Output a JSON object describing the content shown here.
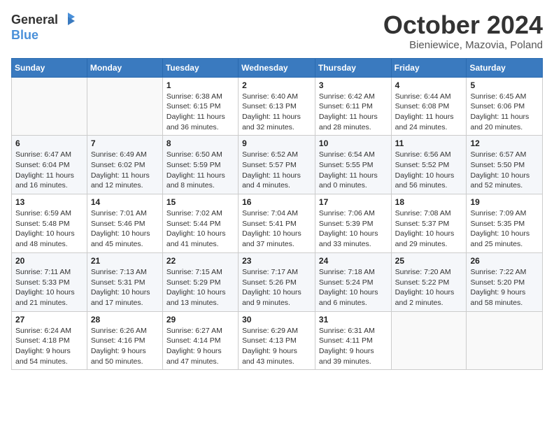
{
  "logo": {
    "text_general": "General",
    "text_blue": "Blue"
  },
  "title": {
    "month": "October 2024",
    "location": "Bieniewice, Mazovia, Poland"
  },
  "weekdays": [
    "Sunday",
    "Monday",
    "Tuesday",
    "Wednesday",
    "Thursday",
    "Friday",
    "Saturday"
  ],
  "weeks": [
    [
      {
        "day": "",
        "info": ""
      },
      {
        "day": "",
        "info": ""
      },
      {
        "day": "1",
        "info": "Sunrise: 6:38 AM\nSunset: 6:15 PM\nDaylight: 11 hours and 36 minutes."
      },
      {
        "day": "2",
        "info": "Sunrise: 6:40 AM\nSunset: 6:13 PM\nDaylight: 11 hours and 32 minutes."
      },
      {
        "day": "3",
        "info": "Sunrise: 6:42 AM\nSunset: 6:11 PM\nDaylight: 11 hours and 28 minutes."
      },
      {
        "day": "4",
        "info": "Sunrise: 6:44 AM\nSunset: 6:08 PM\nDaylight: 11 hours and 24 minutes."
      },
      {
        "day": "5",
        "info": "Sunrise: 6:45 AM\nSunset: 6:06 PM\nDaylight: 11 hours and 20 minutes."
      }
    ],
    [
      {
        "day": "6",
        "info": "Sunrise: 6:47 AM\nSunset: 6:04 PM\nDaylight: 11 hours and 16 minutes."
      },
      {
        "day": "7",
        "info": "Sunrise: 6:49 AM\nSunset: 6:02 PM\nDaylight: 11 hours and 12 minutes."
      },
      {
        "day": "8",
        "info": "Sunrise: 6:50 AM\nSunset: 5:59 PM\nDaylight: 11 hours and 8 minutes."
      },
      {
        "day": "9",
        "info": "Sunrise: 6:52 AM\nSunset: 5:57 PM\nDaylight: 11 hours and 4 minutes."
      },
      {
        "day": "10",
        "info": "Sunrise: 6:54 AM\nSunset: 5:55 PM\nDaylight: 11 hours and 0 minutes."
      },
      {
        "day": "11",
        "info": "Sunrise: 6:56 AM\nSunset: 5:52 PM\nDaylight: 10 hours and 56 minutes."
      },
      {
        "day": "12",
        "info": "Sunrise: 6:57 AM\nSunset: 5:50 PM\nDaylight: 10 hours and 52 minutes."
      }
    ],
    [
      {
        "day": "13",
        "info": "Sunrise: 6:59 AM\nSunset: 5:48 PM\nDaylight: 10 hours and 48 minutes."
      },
      {
        "day": "14",
        "info": "Sunrise: 7:01 AM\nSunset: 5:46 PM\nDaylight: 10 hours and 45 minutes."
      },
      {
        "day": "15",
        "info": "Sunrise: 7:02 AM\nSunset: 5:44 PM\nDaylight: 10 hours and 41 minutes."
      },
      {
        "day": "16",
        "info": "Sunrise: 7:04 AM\nSunset: 5:41 PM\nDaylight: 10 hours and 37 minutes."
      },
      {
        "day": "17",
        "info": "Sunrise: 7:06 AM\nSunset: 5:39 PM\nDaylight: 10 hours and 33 minutes."
      },
      {
        "day": "18",
        "info": "Sunrise: 7:08 AM\nSunset: 5:37 PM\nDaylight: 10 hours and 29 minutes."
      },
      {
        "day": "19",
        "info": "Sunrise: 7:09 AM\nSunset: 5:35 PM\nDaylight: 10 hours and 25 minutes."
      }
    ],
    [
      {
        "day": "20",
        "info": "Sunrise: 7:11 AM\nSunset: 5:33 PM\nDaylight: 10 hours and 21 minutes."
      },
      {
        "day": "21",
        "info": "Sunrise: 7:13 AM\nSunset: 5:31 PM\nDaylight: 10 hours and 17 minutes."
      },
      {
        "day": "22",
        "info": "Sunrise: 7:15 AM\nSunset: 5:29 PM\nDaylight: 10 hours and 13 minutes."
      },
      {
        "day": "23",
        "info": "Sunrise: 7:17 AM\nSunset: 5:26 PM\nDaylight: 10 hours and 9 minutes."
      },
      {
        "day": "24",
        "info": "Sunrise: 7:18 AM\nSunset: 5:24 PM\nDaylight: 10 hours and 6 minutes."
      },
      {
        "day": "25",
        "info": "Sunrise: 7:20 AM\nSunset: 5:22 PM\nDaylight: 10 hours and 2 minutes."
      },
      {
        "day": "26",
        "info": "Sunrise: 7:22 AM\nSunset: 5:20 PM\nDaylight: 9 hours and 58 minutes."
      }
    ],
    [
      {
        "day": "27",
        "info": "Sunrise: 6:24 AM\nSunset: 4:18 PM\nDaylight: 9 hours and 54 minutes."
      },
      {
        "day": "28",
        "info": "Sunrise: 6:26 AM\nSunset: 4:16 PM\nDaylight: 9 hours and 50 minutes."
      },
      {
        "day": "29",
        "info": "Sunrise: 6:27 AM\nSunset: 4:14 PM\nDaylight: 9 hours and 47 minutes."
      },
      {
        "day": "30",
        "info": "Sunrise: 6:29 AM\nSunset: 4:13 PM\nDaylight: 9 hours and 43 minutes."
      },
      {
        "day": "31",
        "info": "Sunrise: 6:31 AM\nSunset: 4:11 PM\nDaylight: 9 hours and 39 minutes."
      },
      {
        "day": "",
        "info": ""
      },
      {
        "day": "",
        "info": ""
      }
    ]
  ]
}
